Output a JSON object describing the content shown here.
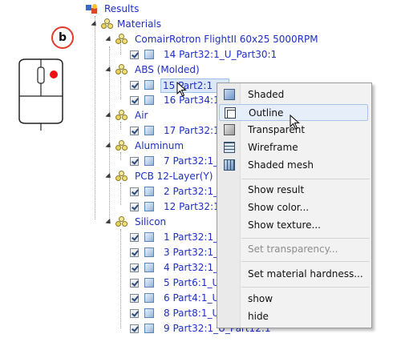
{
  "badge": {
    "letter": "b",
    "border_color": "#e03b2b"
  },
  "tree": {
    "root": {
      "label": "Results"
    },
    "materials": {
      "label": "Materials"
    },
    "groups": [
      {
        "label": "ComairRotron FlightII 60x25 5000RPM",
        "parts": [
          "14 Part32:1_U_Part30:1"
        ]
      },
      {
        "label": "ABS (Molded)",
        "parts": [
          "15 Part2:1",
          "16 Part34:1_"
        ]
      },
      {
        "label": "Air",
        "parts": [
          "17 Part32:1"
        ]
      },
      {
        "label": "Aluminum",
        "parts": [
          "7 Part32:1_U"
        ]
      },
      {
        "label": "PCB 12-Layer(Y)",
        "parts": [
          "2 Part32:1_U",
          "12 Part32:1_"
        ]
      },
      {
        "label": "Silicon",
        "parts": [
          "1 Part32:1_U",
          "3 Part32:1_U",
          "4 Part32:1_U",
          "5 Part6:1_U",
          "6 Part4:1_U",
          "8 Part8:1_U",
          "9 Part32:1_U_Part12:1"
        ]
      }
    ]
  },
  "context_menu": {
    "items": [
      {
        "label": "Shaded",
        "icon": "shaded-cube-icon",
        "disabled": false
      },
      {
        "label": "Outline",
        "icon": "outline-cube-icon",
        "disabled": false,
        "hover": true
      },
      {
        "label": "Transparent",
        "icon": "transparent-cube-icon",
        "disabled": false
      },
      {
        "label": "Wireframe",
        "icon": "wireframe-cube-icon",
        "disabled": false
      },
      {
        "label": "Shaded mesh",
        "icon": "shaded-mesh-icon",
        "disabled": false
      },
      {
        "label": "Show result",
        "disabled": false
      },
      {
        "label": "Show color...",
        "disabled": false
      },
      {
        "label": "Show texture...",
        "disabled": false
      },
      {
        "label": "Set transparency...",
        "disabled": true
      },
      {
        "label": "Set material hardness...",
        "disabled": false
      },
      {
        "label": "show",
        "disabled": false
      },
      {
        "label": "hide",
        "disabled": false
      }
    ]
  }
}
